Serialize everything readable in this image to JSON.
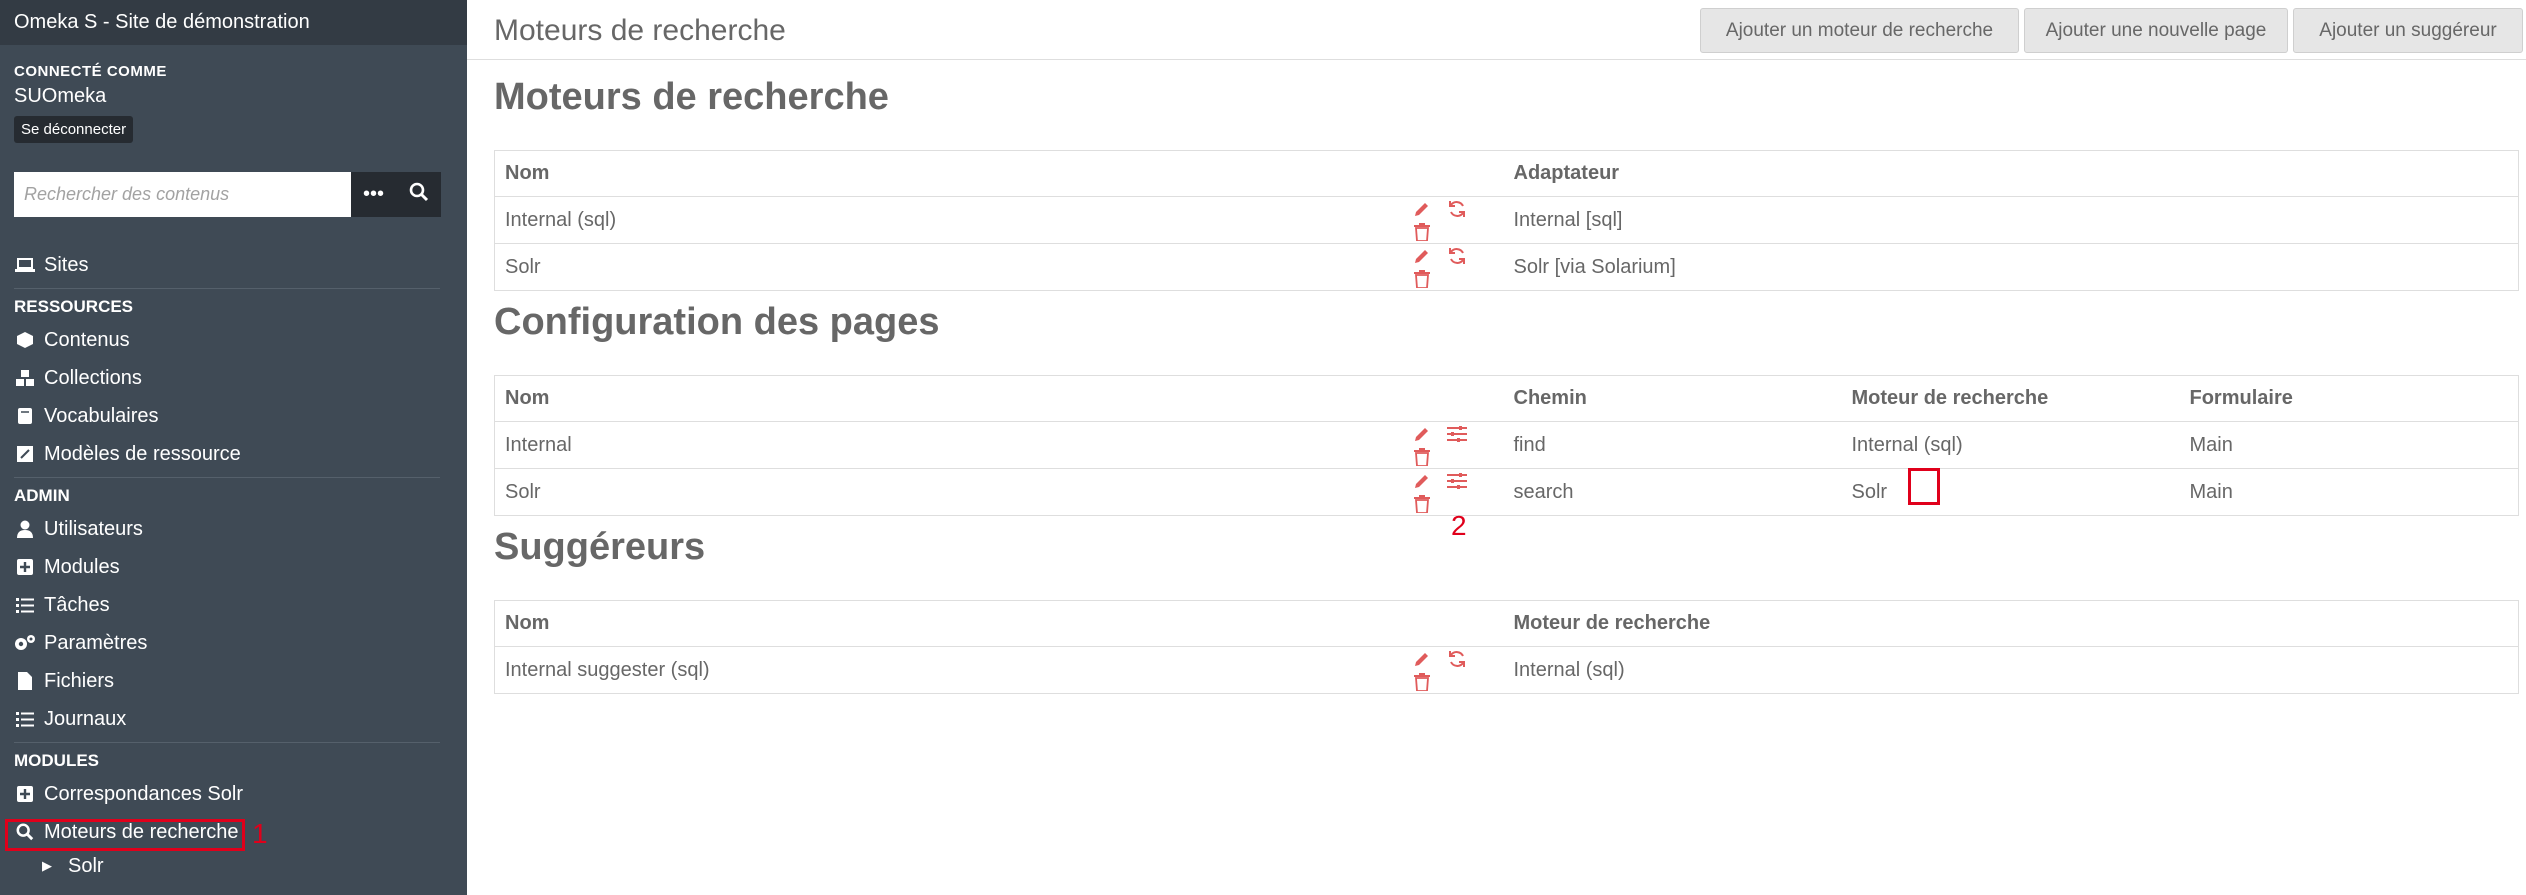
{
  "sidebar": {
    "site_title": "Omeka S - Site de démonstration",
    "connected_label": "CONNECTÉ COMME",
    "username": "SUOmeka",
    "logout": "Se déconnecter",
    "search_placeholder": "Rechercher des contenus",
    "sites": "Sites",
    "sections": {
      "resources": "RESSOURCES",
      "admin": "ADMIN",
      "modules": "MODULES"
    },
    "resources": [
      "Contenus",
      "Collections",
      "Vocabulaires",
      "Modèles de ressource"
    ],
    "admin": [
      "Utilisateurs",
      "Modules",
      "Tâches",
      "Paramètres",
      "Fichiers",
      "Journaux"
    ],
    "modules": [
      "Correspondances Solr",
      "Moteurs de recherche"
    ],
    "sub": "Solr",
    "marker_1": "1"
  },
  "header": {
    "title": "Moteurs de recherche",
    "buttons": [
      "Ajouter un moteur de recherche",
      "Ajouter une nouvelle page",
      "Ajouter un suggéreur"
    ]
  },
  "engines": {
    "heading": "Moteurs de recherche",
    "columns": [
      "Nom",
      "Adaptateur"
    ],
    "rows": [
      {
        "name": "Internal (sql)",
        "adapter": "Internal [sql]"
      },
      {
        "name": "Solr",
        "adapter": "Solr [via Solarium]"
      }
    ]
  },
  "pages": {
    "heading": "Configuration des pages",
    "columns": [
      "Nom",
      "Chemin",
      "Moteur de recherche",
      "Formulaire"
    ],
    "rows": [
      {
        "name": "Internal",
        "path": "find",
        "engine": "Internal (sql)",
        "form": "Main"
      },
      {
        "name": "Solr",
        "path": "search",
        "engine": "Solr",
        "form": "Main"
      }
    ],
    "marker_2": "2"
  },
  "suggesters": {
    "heading": "Suggéreurs",
    "columns": [
      "Nom",
      "Moteur de recherche"
    ],
    "rows": [
      {
        "name": "Internal suggester (sql)",
        "engine": "Internal (sql)"
      }
    ]
  },
  "colors": {
    "sidebar": "#3f4a55",
    "accent_red": "#e0001b",
    "action_icon": "#e05b5b"
  }
}
